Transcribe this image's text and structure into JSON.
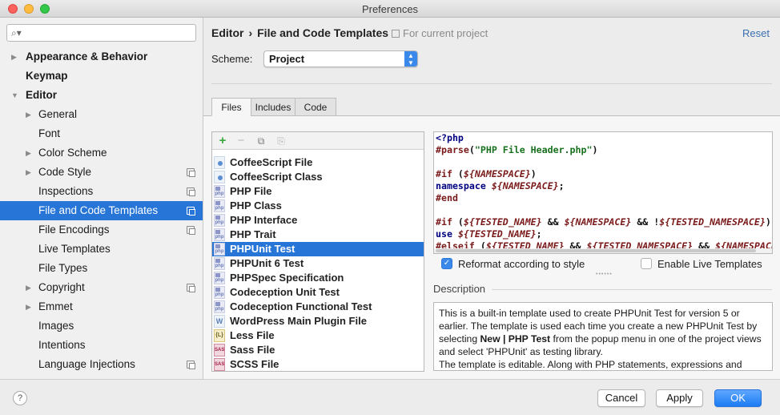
{
  "window": {
    "title": "Preferences"
  },
  "search": {
    "placeholder": "",
    "icon": "search-icon"
  },
  "sidebar": {
    "items": [
      {
        "label": "Appearance & Behavior",
        "bold": true,
        "arrow": "▶",
        "project": false
      },
      {
        "label": "Keymap",
        "bold": true,
        "arrow": "",
        "project": false
      },
      {
        "label": "Editor",
        "bold": true,
        "arrow": "▼",
        "project": false
      },
      {
        "label": "General",
        "bold": false,
        "arrow": "▶",
        "project": false
      },
      {
        "label": "Font",
        "bold": false,
        "arrow": "",
        "project": false
      },
      {
        "label": "Color Scheme",
        "bold": false,
        "arrow": "▶",
        "project": false
      },
      {
        "label": "Code Style",
        "bold": false,
        "arrow": "▶",
        "project": true
      },
      {
        "label": "Inspections",
        "bold": false,
        "arrow": "",
        "project": true
      },
      {
        "label": "File and Code Templates",
        "bold": false,
        "arrow": "",
        "project": true,
        "selected": true
      },
      {
        "label": "File Encodings",
        "bold": false,
        "arrow": "",
        "project": true
      },
      {
        "label": "Live Templates",
        "bold": false,
        "arrow": "",
        "project": false
      },
      {
        "label": "File Types",
        "bold": false,
        "arrow": "",
        "project": false
      },
      {
        "label": "Copyright",
        "bold": false,
        "arrow": "▶",
        "project": true
      },
      {
        "label": "Emmet",
        "bold": false,
        "arrow": "▶",
        "project": false
      },
      {
        "label": "Images",
        "bold": false,
        "arrow": "",
        "project": false
      },
      {
        "label": "Intentions",
        "bold": false,
        "arrow": "",
        "project": false
      },
      {
        "label": "Language Injections",
        "bold": false,
        "arrow": "",
        "project": true
      }
    ]
  },
  "header": {
    "crumb_parent": "Editor",
    "crumb_separator": "›",
    "crumb_current": "File and Code Templates",
    "project_note": "For current project",
    "reset_label": "Reset"
  },
  "scheme": {
    "label": "Scheme:",
    "value": "Project"
  },
  "tabs": [
    {
      "label": "Files",
      "active": true
    },
    {
      "label": "Includes",
      "active": false
    },
    {
      "label": "Code",
      "active": false
    }
  ],
  "toolbar": {
    "add": "+",
    "remove": "−",
    "copy": "⧉",
    "reset": "⎘"
  },
  "templates": [
    {
      "label": "CoffeeScript File",
      "icon": "coffee",
      "icon_text": ""
    },
    {
      "label": "CoffeeScript Class",
      "icon": "coffee",
      "icon_text": ""
    },
    {
      "label": "PHP File",
      "icon": "php",
      "icon_text": "php"
    },
    {
      "label": "PHP Class",
      "icon": "php",
      "icon_text": "php"
    },
    {
      "label": "PHP Interface",
      "icon": "php",
      "icon_text": "php"
    },
    {
      "label": "PHP Trait",
      "icon": "php",
      "icon_text": "php"
    },
    {
      "label": "PHPUnit Test",
      "icon": "php",
      "icon_text": "php",
      "selected": true
    },
    {
      "label": "PHPUnit 6 Test",
      "icon": "php",
      "icon_text": "php"
    },
    {
      "label": "PHPSpec Specification",
      "icon": "php",
      "icon_text": "php"
    },
    {
      "label": "Codeception Unit Test",
      "icon": "php",
      "icon_text": "php"
    },
    {
      "label": "Codeception Functional Test",
      "icon": "php",
      "icon_text": "php"
    },
    {
      "label": "WordPress Main Plugin File",
      "icon": "wp",
      "icon_text": "W"
    },
    {
      "label": "Less File",
      "icon": "less",
      "icon_text": "{L}"
    },
    {
      "label": "Sass File",
      "icon": "sass",
      "icon_text": "SASS"
    },
    {
      "label": "SCSS File",
      "icon": "sass",
      "icon_text": "SASS"
    }
  ],
  "code": {
    "lines": [
      [
        {
          "t": "<?php",
          "c": "k-navy"
        }
      ],
      [
        {
          "t": "#parse",
          "c": "k-kw"
        },
        {
          "t": "(",
          "c": "k-plain"
        },
        {
          "t": "\"PHP File Header.php\"",
          "c": "k-str"
        },
        {
          "t": ")",
          "c": "k-plain"
        }
      ],
      [],
      [
        {
          "t": "#if",
          "c": "k-kw"
        },
        {
          "t": " (",
          "c": "k-plain"
        },
        {
          "t": "${NAMESPACE}",
          "c": "k-var"
        },
        {
          "t": ")",
          "c": "k-plain"
        }
      ],
      [
        {
          "t": "namespace",
          "c": "k-navy"
        },
        {
          "t": " ",
          "c": "k-plain"
        },
        {
          "t": "${NAMESPACE}",
          "c": "k-var"
        },
        {
          "t": ";",
          "c": "k-plain"
        }
      ],
      [
        {
          "t": "#end",
          "c": "k-kw"
        }
      ],
      [],
      [
        {
          "t": "#if",
          "c": "k-kw"
        },
        {
          "t": " (",
          "c": "k-plain"
        },
        {
          "t": "${TESTED_NAME}",
          "c": "k-var"
        },
        {
          "t": " && ",
          "c": "k-plain"
        },
        {
          "t": "${NAMESPACE}",
          "c": "k-var"
        },
        {
          "t": " && !",
          "c": "k-plain"
        },
        {
          "t": "${TESTED_NAMESPACE}",
          "c": "k-var"
        },
        {
          "t": ")",
          "c": "k-plain"
        }
      ],
      [
        {
          "t": "use",
          "c": "k-navy"
        },
        {
          "t": " ",
          "c": "k-plain"
        },
        {
          "t": "${TESTED_NAME}",
          "c": "k-var"
        },
        {
          "t": ";",
          "c": "k-plain"
        }
      ],
      [
        {
          "t": "#elseif",
          "c": "k-kw"
        },
        {
          "t": " (",
          "c": "k-plain"
        },
        {
          "t": "${TESTED_NAME}",
          "c": "k-var"
        },
        {
          "t": " && ",
          "c": "k-plain"
        },
        {
          "t": "${TESTED_NAMESPACE}",
          "c": "k-var"
        },
        {
          "t": " && ",
          "c": "k-plain"
        },
        {
          "t": "${NAMESPACE}",
          "c": "k-var"
        }
      ]
    ]
  },
  "options": {
    "reformat_label": "Reformat according to style",
    "reformat_checked": true,
    "live_templates_label": "Enable Live Templates",
    "live_templates_checked": false
  },
  "description": {
    "title": "Description",
    "text_1": "This is a built-in template used to create PHPUnit Test for version 5 or earlier. The template is used each time you create a new PHPUnit Test by selecting ",
    "text_bold": "New | PHP Test",
    "text_2": " from the popup menu in one of the project views and select 'PHPUnit' as testing library.",
    "text_3": "The template is editable. Along with PHP statements, expressions and"
  },
  "buttons": {
    "help": "?",
    "cancel": "Cancel",
    "apply": "Apply",
    "ok": "OK"
  },
  "colors": {
    "selection": "#2675d7",
    "accent": "#3b88eb",
    "link": "#3a6fb0"
  }
}
